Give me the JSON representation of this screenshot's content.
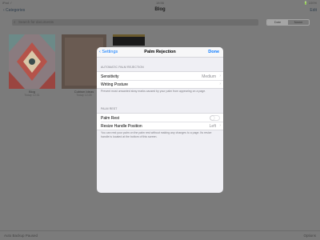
{
  "status_bar": {
    "left": "iPad ✓",
    "time": "18:56",
    "right": "🔋 100%"
  },
  "nav": {
    "back_label": "‹ Categories",
    "title": "Blog",
    "edit_label": "Edit"
  },
  "search": {
    "placeholder": "Search for documents"
  },
  "segment": {
    "items": [
      "Date",
      "Name"
    ]
  },
  "documents": [
    {
      "name": "Blog",
      "date": "Today 12:31"
    },
    {
      "name": "Cubism Ideas",
      "date": "Today 12:25"
    }
  ],
  "bottom_bar": {
    "left": "Auto Backup Paused",
    "right": "Options"
  },
  "modal": {
    "back_label": "Settings",
    "title": "Palm Rejection",
    "done_label": "Done",
    "section1": {
      "header": "AUTOMATIC PALM REJECTION",
      "sensitivity_label": "Sensitivity",
      "sensitivity_value": "Medium",
      "writing_posture_label": "Writing Posture",
      "footer": "Prevent most unwanted stray marks caused by your palm from appearing on a page."
    },
    "section2": {
      "header": "PALM REST",
      "palm_rest_label": "Palm Rest",
      "palm_rest_on": false,
      "resize_label": "Resize Handle Position",
      "resize_value": "Left",
      "footer": "You can rest your palm on the palm rest without making any changes to a page. Its resize handle is located at the bottom of this screen."
    }
  }
}
